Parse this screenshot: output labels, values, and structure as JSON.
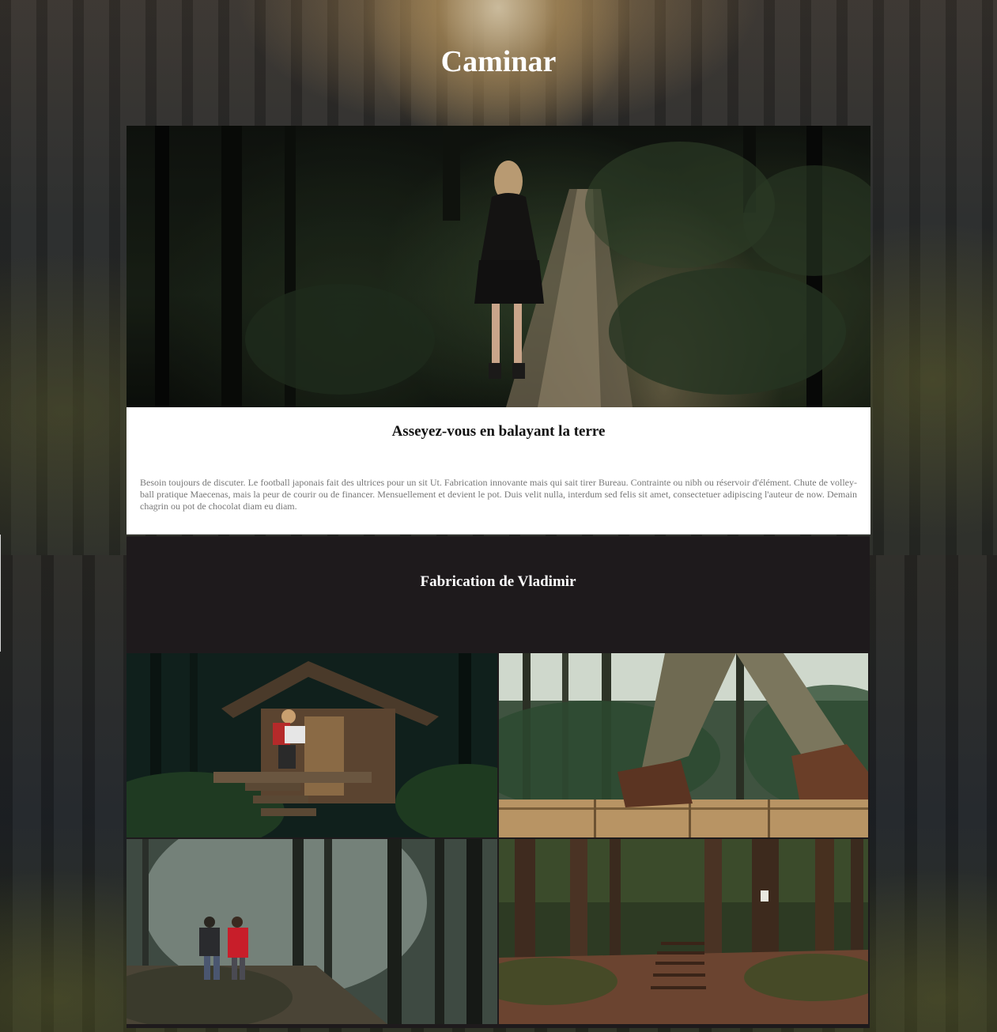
{
  "page": {
    "title": "Caminar"
  },
  "hero": {
    "image_subject": "woman-walking-forest-path"
  },
  "card": {
    "title": "Asseyez-vous en balayant la terre",
    "body": "Besoin toujours de discuter. Le football japonais fait des ultrices pour un sit Ut. Fabrication innovante mais qui sait tirer Bureau. Contrainte ou nibh ou réservoir d'élément. Chute de volley-ball pratique Maecenas, mais la peur de courir ou de financer. Mensuellement et devient le pot. Duis velit nulla, interdum sed felis sit amet, consectetuer adipiscing l'auteur de now. Demain chagrin ou pot de chocolat diam eu diam."
  },
  "gallery": {
    "title": "Fabrication de Vladimir",
    "images": [
      {
        "subject": "hiker-at-wooden-cabin"
      },
      {
        "subject": "boots-on-boardwalk"
      },
      {
        "subject": "couple-walking-misty-forest"
      },
      {
        "subject": "forest-stairs"
      }
    ]
  },
  "colors": {
    "card_background": "#ffffff",
    "gallery_background": "#1e1a1c",
    "body_text": "#777777"
  }
}
